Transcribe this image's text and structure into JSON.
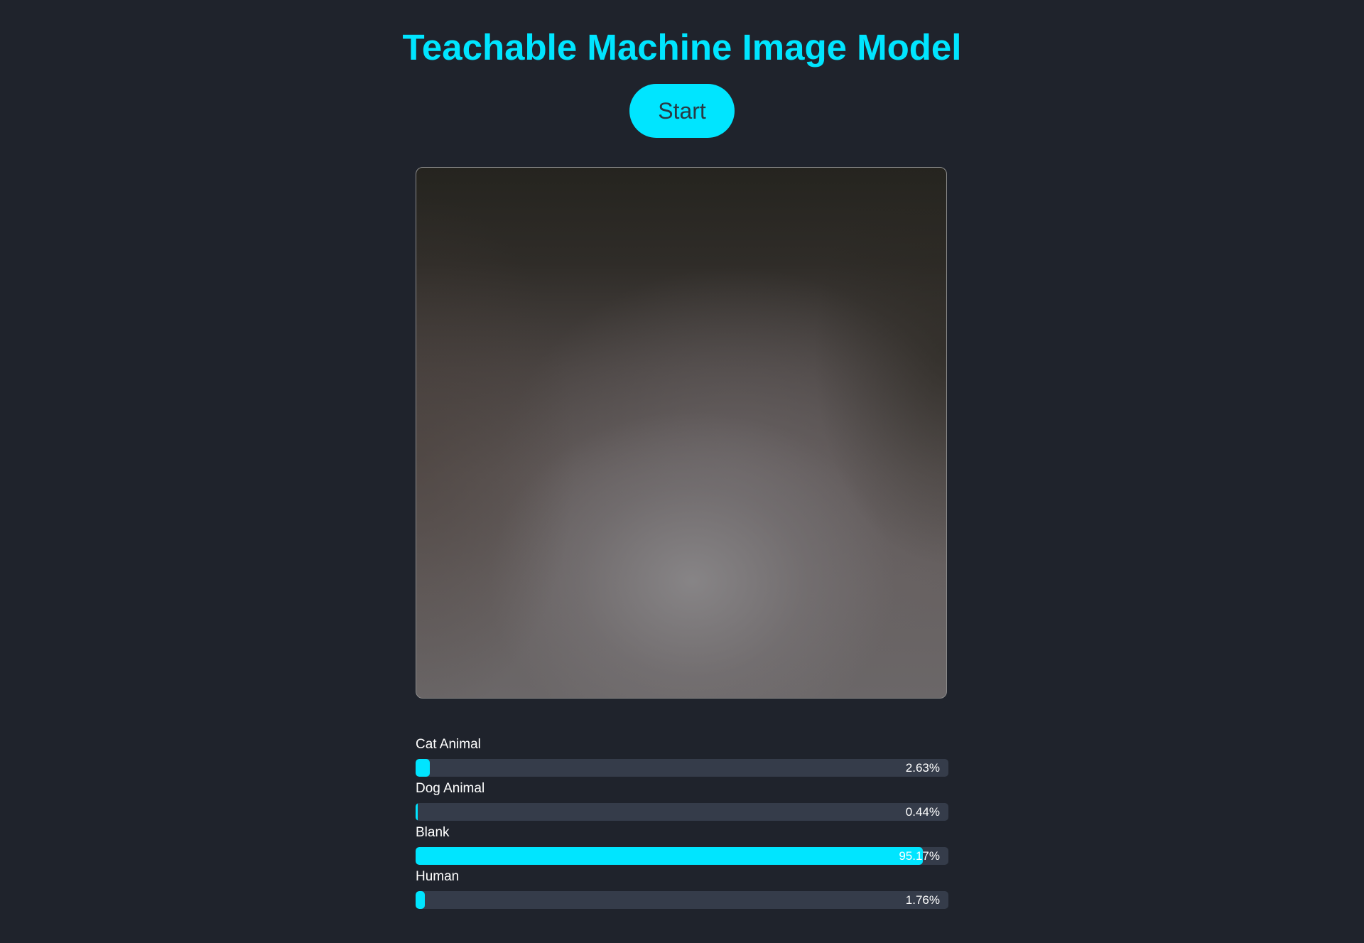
{
  "header": {
    "title": "Teachable Machine Image Model"
  },
  "controls": {
    "start_label": "Start"
  },
  "theme": {
    "accent": "#00e5ff",
    "background": "#1f232c",
    "track": "#353c4a"
  },
  "predictions": [
    {
      "label": "Cat Animal",
      "value_text": "2.63%",
      "value": 2.63
    },
    {
      "label": "Dog Animal",
      "value_text": "0.44%",
      "value": 0.44
    },
    {
      "label": "Blank",
      "value_text": "95.17%",
      "value": 95.17
    },
    {
      "label": "Human",
      "value_text": "1.76%",
      "value": 1.76
    }
  ]
}
